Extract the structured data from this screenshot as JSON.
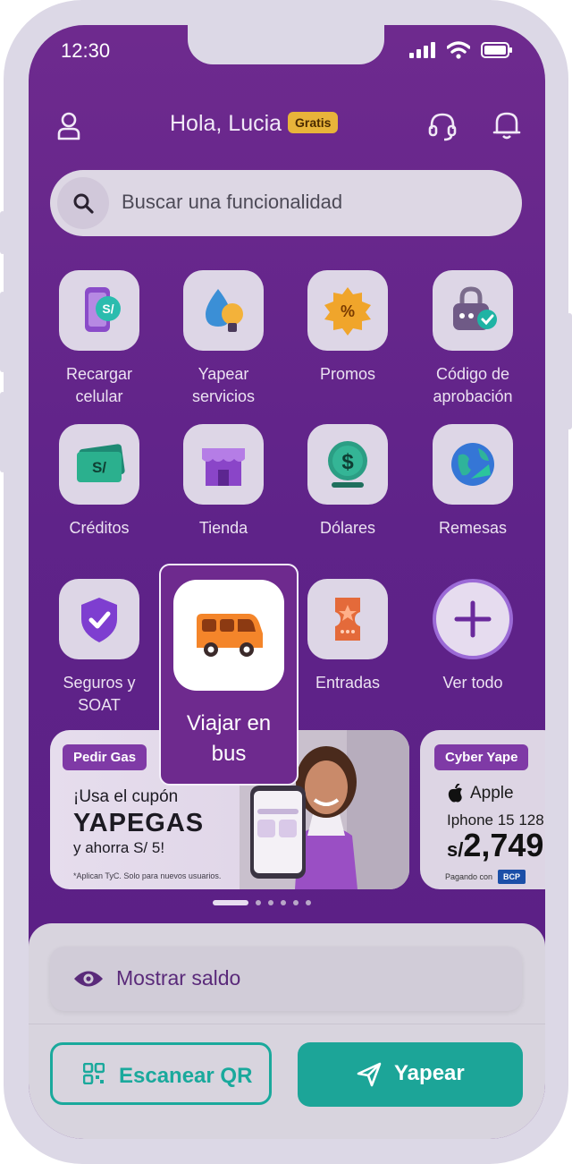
{
  "status_bar": {
    "time": "12:30"
  },
  "header": {
    "greeting": "Hola, Lucia",
    "badge": "Gratis"
  },
  "search": {
    "placeholder": "Buscar una funcionalidad"
  },
  "grid": [
    {
      "label_line1": "Recargar",
      "label_line2": "celular",
      "icon": "phone-recharge-icon"
    },
    {
      "label_line1": "Yapear",
      "label_line2": "servicios",
      "icon": "water-bulb-icon"
    },
    {
      "label_line1": "Promos",
      "label_line2": "",
      "icon": "promo-badge-icon"
    },
    {
      "label_line1": "Código de",
      "label_line2": "aprobación",
      "icon": "lock-check-icon"
    },
    {
      "label_line1": "Créditos",
      "label_line2": "",
      "icon": "money-bill-icon"
    },
    {
      "label_line1": "Tienda",
      "label_line2": "",
      "icon": "store-icon"
    },
    {
      "label_line1": "Dólares",
      "label_line2": "",
      "icon": "dollar-coin-icon"
    },
    {
      "label_line1": "Remesas",
      "label_line2": "",
      "icon": "globe-arrow-icon"
    },
    {
      "label_line1": "Seguros y",
      "label_line2": "SOAT",
      "icon": "shield-check-icon"
    },
    {
      "label_line1": "Entradas",
      "label_line2": "",
      "icon": "ticket-icon"
    },
    {
      "label_line1": "Ver todo",
      "label_line2": "",
      "icon": "plus-icon"
    }
  ],
  "highlight": {
    "label_line1": "Viajar en",
    "label_line2": "bus",
    "icon": "bus-icon"
  },
  "banners": [
    {
      "tag": "Pedir Gas",
      "line1": "¡Usa el cupón",
      "line2": "YAPEGAS",
      "line3": "y ahorra S/ 5!",
      "footnote": "*Aplican TyC. Solo para nuevos usuarios."
    },
    {
      "tag": "Cyber Yape",
      "brand": "Apple",
      "product": "Iphone 15 128",
      "currency": "s/",
      "price": "2,749",
      "pay_note": "Pagando con",
      "card_label": "BCP"
    }
  ],
  "carousel": {
    "dots": 6,
    "active": 0
  },
  "balance": {
    "label": "Mostrar saldo"
  },
  "actions": {
    "scan_label": "Escanear QR",
    "yapear_label": "Yapear"
  },
  "colors": {
    "purple": "#5f2389",
    "teal": "#1ca598",
    "badge": "#e8b43a"
  }
}
